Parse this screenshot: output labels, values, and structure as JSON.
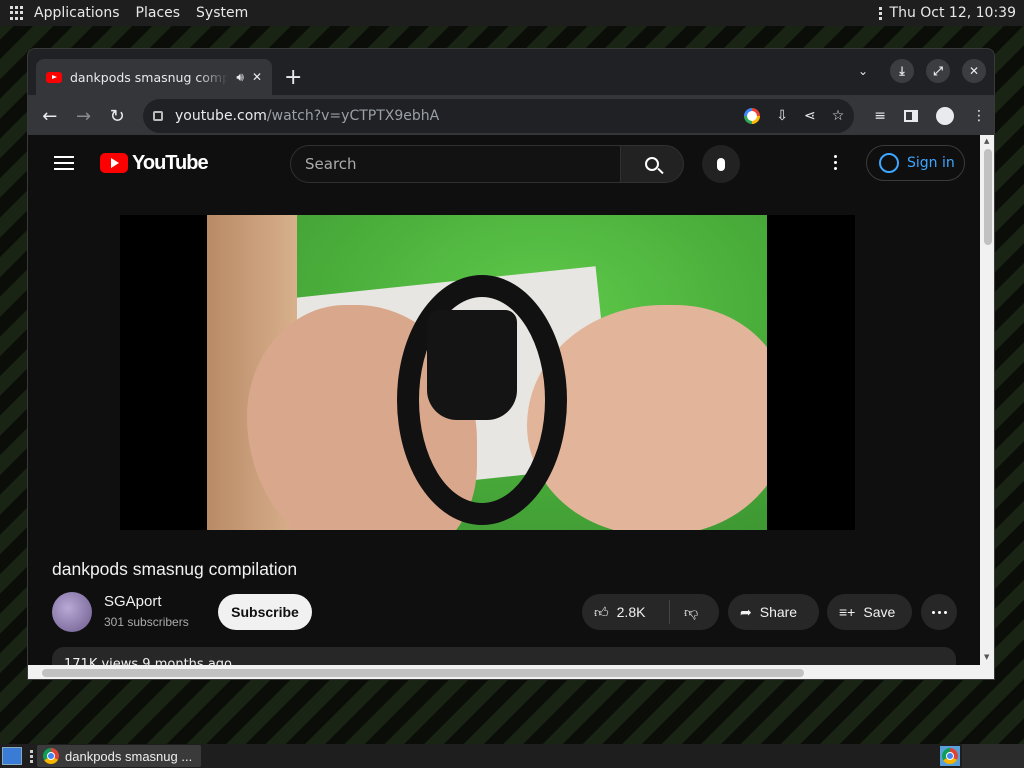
{
  "top_panel": {
    "menu": [
      "Applications",
      "Places",
      "System"
    ],
    "clock": "Thu Oct 12, 10:39"
  },
  "browser": {
    "tab": {
      "title": "dankpods smasnug compilation",
      "audio_icon": "speaker-icon",
      "close_icon": "close-icon"
    },
    "new_tab_label": "+",
    "url_host": "youtube.com",
    "url_path": "/watch?v=yCTPTX9ebhA"
  },
  "youtube": {
    "logo_text": "YouTube",
    "search_placeholder": "Search",
    "signin_label": "Sign in",
    "video_title": "dankpods smasnug compilation",
    "channel_name": "SGAport",
    "subscribers": "301 subscribers",
    "subscribe_label": "Subscribe",
    "likes": "2.8K",
    "share_label": "Share",
    "save_label": "Save",
    "description_peek": "171K views  9 months ago"
  },
  "taskbar": {
    "task_label": "dankpods smasnug ..."
  },
  "colors": {
    "youtube_red": "#ff0000",
    "link_blue": "#3ea6ff",
    "page_bg": "#0f0f0f"
  }
}
